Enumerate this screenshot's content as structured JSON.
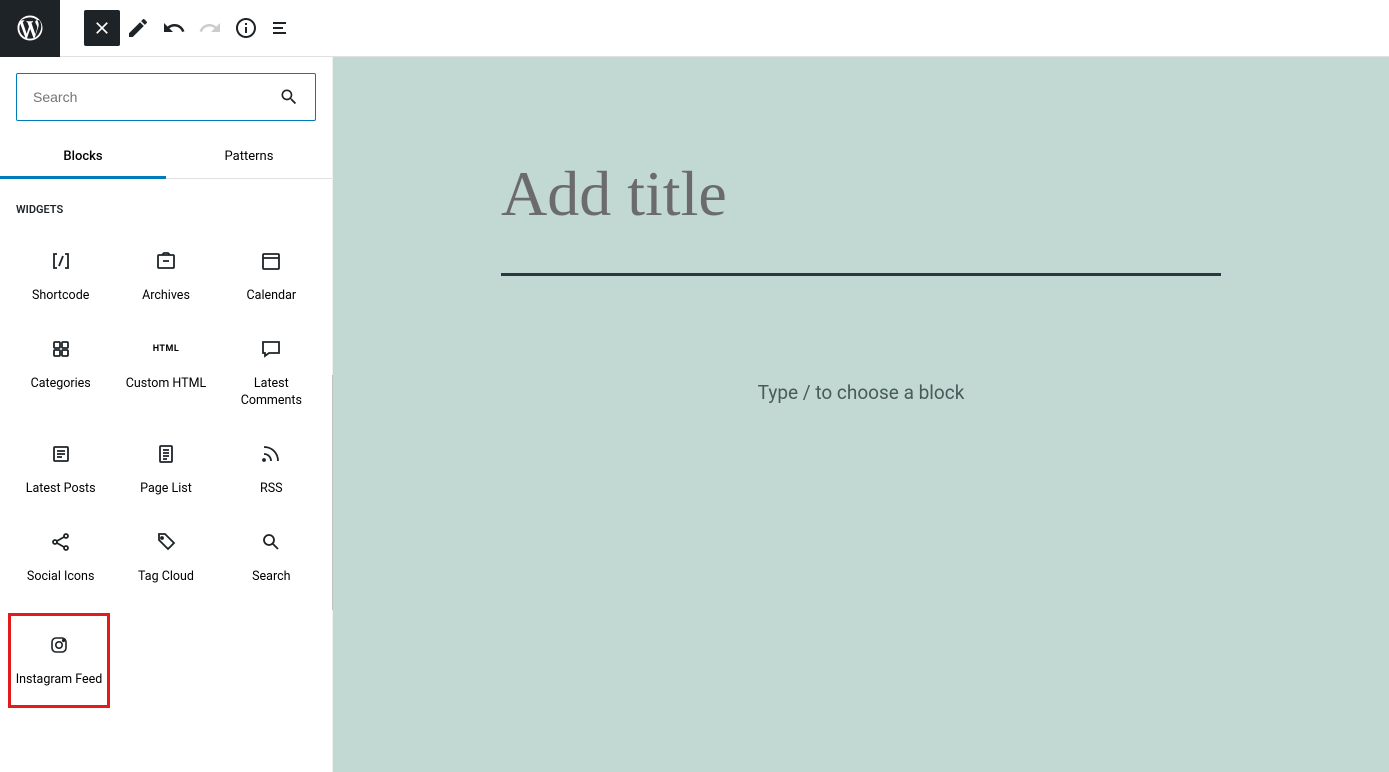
{
  "search": {
    "placeholder": "Search"
  },
  "tabs": {
    "blocks": "Blocks",
    "patterns": "Patterns"
  },
  "section_title": "WIDGETS",
  "blocks": {
    "shortcode": "Shortcode",
    "archives": "Archives",
    "calendar": "Calendar",
    "categories": "Categories",
    "custom_html": "Custom HTML",
    "custom_html_icon": "HTML",
    "latest_comments": "Latest Comments",
    "latest_posts": "Latest Posts",
    "page_list": "Page List",
    "rss": "RSS",
    "social_icons": "Social Icons",
    "tag_cloud": "Tag Cloud",
    "search": "Search",
    "instagram_feed": "Instagram Feed"
  },
  "editor": {
    "title_placeholder": "Add title",
    "block_prompt": "Type / to choose a block"
  }
}
